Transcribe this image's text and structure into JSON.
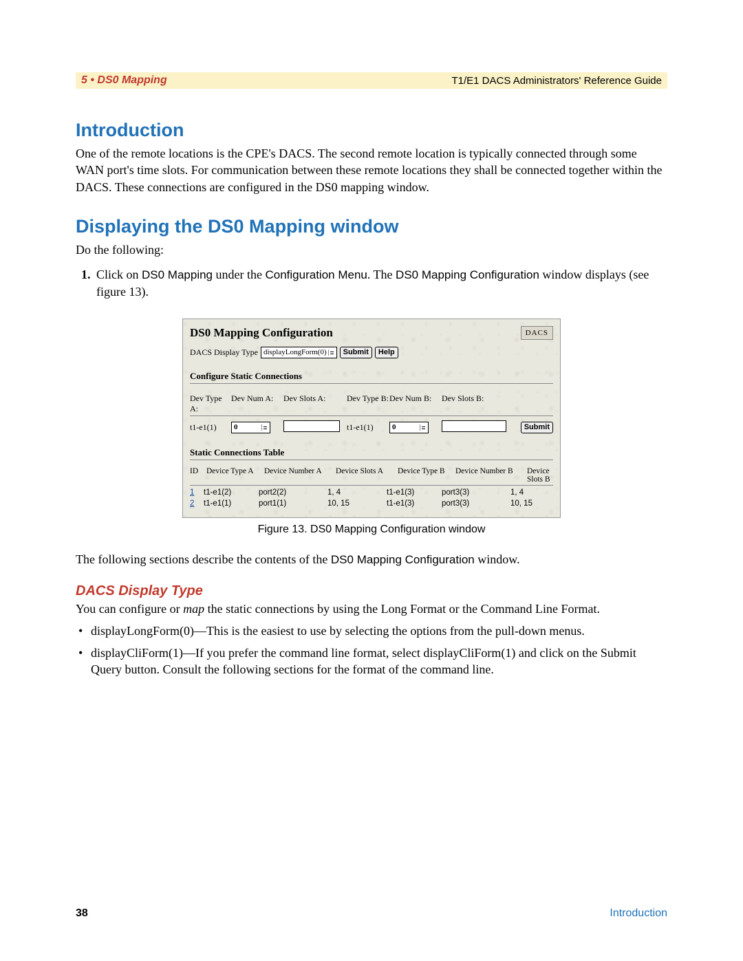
{
  "header": {
    "left": "5 • DS0 Mapping",
    "right": "T1/E1 DACS Administrators' Reference Guide"
  },
  "section1": {
    "title": "Introduction",
    "body": "One of the remote locations is the CPE's DACS. The second remote location is typically connected through some WAN port's time slots. For communication between these remote locations they shall be connected together within the DACS. These  connections are configured in the DS0 mapping window."
  },
  "section2": {
    "title": "Displaying the DS0 Mapping window",
    "lead": "Do the following:",
    "step1_a": "Click on ",
    "step1_term1": "DS0 Mapping",
    "step1_b": " under the ",
    "step1_term2": "Configuration Menu",
    "step1_c": ". The ",
    "step1_term3": "DS0 Mapping Configuration",
    "step1_d": " window displays (see figure 13)."
  },
  "figure": {
    "title": "DS0 Mapping Configuration",
    "badge": "DACS",
    "display_type_label": "DACS Display Type",
    "display_type_value": "displayLongForm(0)",
    "submit_btn": "Submit",
    "help_btn": "Help",
    "sub1": "Configure Static Connections",
    "hdr_devtype_a": "Dev Type A:",
    "hdr_devnum_a": "Dev Num A:",
    "hdr_devslots_a": "Dev Slots A:",
    "hdr_devtype_b": "Dev Type B:",
    "hdr_devnum_b": "Dev Num B:",
    "hdr_devslots_b": "Dev Slots B:",
    "val_devtype_a": "t1-e1(1)",
    "val_devnum_a": "0",
    "val_devtype_b": "t1-e1(1)",
    "val_devnum_b": "0",
    "submit2": "Submit",
    "sub2": "Static Connections Table",
    "thead": {
      "id": "ID",
      "dta": "Device Type A",
      "dna": "Device Number A",
      "dsa": "Device Slots A",
      "dtb": "Device Type B",
      "dnb": "Device Number B",
      "dsb": "Device Slots B"
    },
    "rows": [
      {
        "id": "1",
        "dta": "t1-e1(2)",
        "dna": "port2(2)",
        "dsa": "1, 4",
        "dtb": "t1-e1(3)",
        "dnb": "port3(3)",
        "dsb": "1, 4"
      },
      {
        "id": "2",
        "dta": "t1-e1(1)",
        "dna": "port1(1)",
        "dsa": "10, 15",
        "dtb": "t1-e1(3)",
        "dnb": "port3(3)",
        "dsb": "10, 15"
      }
    ],
    "caption": "Figure 13. DS0 Mapping Configuration window"
  },
  "after_fig_a": "The following sections describe the contents of the ",
  "after_fig_term": "DS0 Mapping Configuration",
  "after_fig_b": " window.",
  "subsection": {
    "title": "DACS Display Type",
    "body_a": "You can configure or ",
    "body_em": "map",
    "body_b": " the static connections by using the Long Format or the Command Line Format.",
    "bullet1": "displayLongForm(0)—This is the easiest to use by selecting the options from the pull-down menus.",
    "bullet2": "displayCliForm(1)—If you prefer the command line format, select displayCliForm(1) and click on the Submit Query button.  Consult the following sections for the format of the command line."
  },
  "footer": {
    "page": "38",
    "section": "Introduction"
  }
}
